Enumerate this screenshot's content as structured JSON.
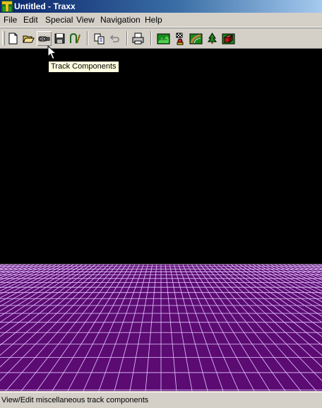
{
  "window": {
    "title": "Untitled - Traxx",
    "app_icon": "traxx-logo-icon"
  },
  "menu": [
    "File",
    "Edit",
    "Special",
    "View",
    "Navigation",
    "Help"
  ],
  "toolbar": {
    "buttons": [
      {
        "name": "new-document-icon"
      },
      {
        "name": "open-folder-icon"
      },
      {
        "name": "track-components-icon",
        "hovered": true
      },
      {
        "name": "save-disk-icon"
      },
      {
        "name": "track-curve-icon"
      },
      {
        "name": "copy-pages-icon"
      },
      {
        "name": "undo-icon",
        "disabled": true
      },
      {
        "name": "print-icon"
      },
      {
        "name": "terrain-icon"
      },
      {
        "name": "race-flag-icon"
      },
      {
        "name": "track-piece-icon"
      },
      {
        "name": "tree-icon"
      },
      {
        "name": "building-icon"
      }
    ]
  },
  "tooltip": "Track Components",
  "status": "View/Edit miscellaneous track components",
  "colors": {
    "ground": "#5c0b73",
    "grid": "#e6c9ff",
    "sky": "#000000",
    "titlebar_start": "#0a246a",
    "titlebar_end": "#a6caf0"
  }
}
